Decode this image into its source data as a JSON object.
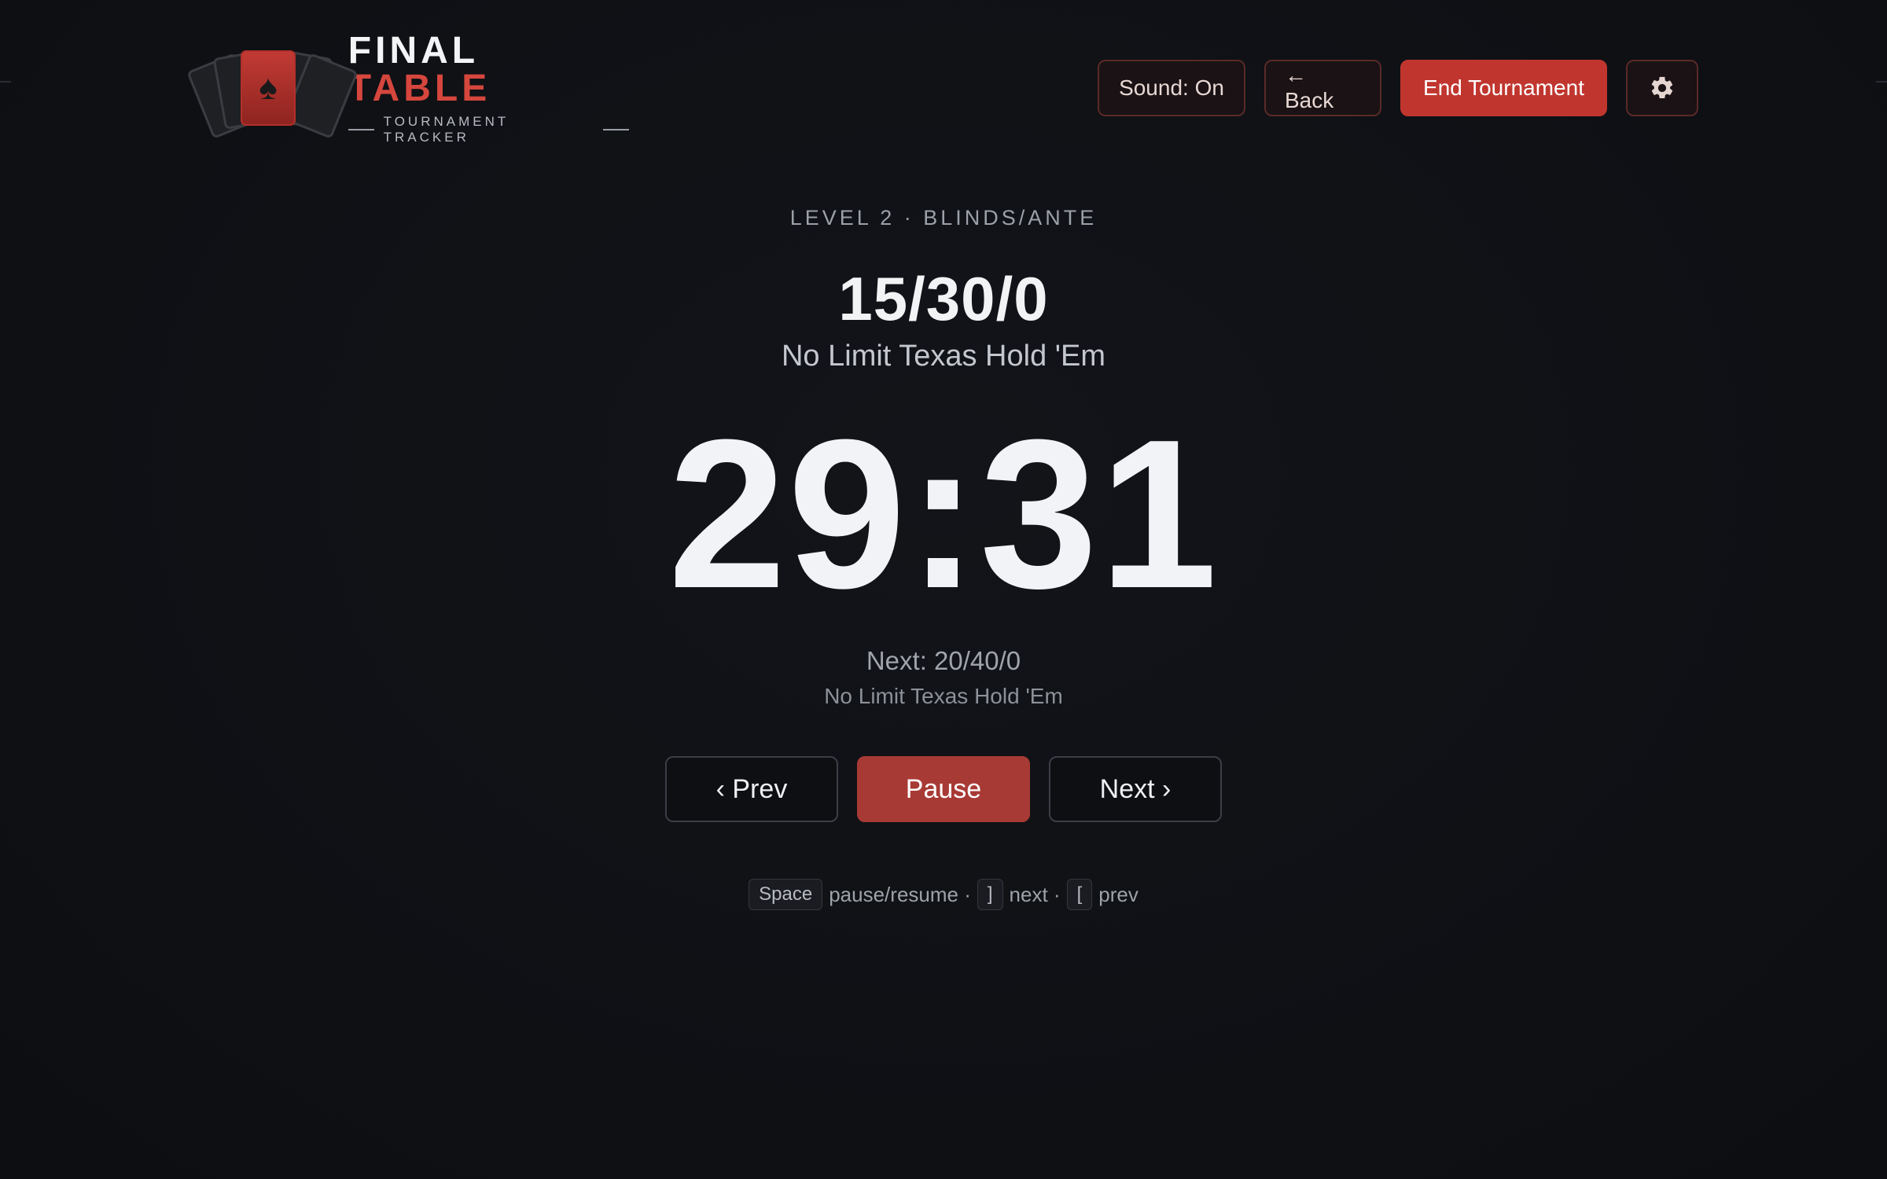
{
  "header": {
    "logo": {
      "title_white": "FINAL",
      "title_red": "TABLE",
      "subtitle": "TOURNAMENT TRACKER"
    },
    "buttons": {
      "sound": "Sound: On",
      "back": "← Back",
      "end": "End Tournament",
      "settings_icon": "gear-icon"
    }
  },
  "level": {
    "label": "LEVEL 2 · BLINDS/ANTE",
    "blinds": "15/30/0",
    "game": "No Limit Texas Hold 'Em"
  },
  "timer": {
    "display": "29:31"
  },
  "next_level": {
    "label": "Next: 20/40/0",
    "game": "No Limit Texas Hold 'Em"
  },
  "controls": {
    "prev": "‹ Prev",
    "pause": "Pause",
    "next": "Next ›"
  },
  "shortcuts": {
    "space_key": "Space",
    "space_desc": "pause/resume ·",
    "next_key": "]",
    "next_desc": "next ·",
    "prev_key": "[",
    "prev_desc": "prev"
  },
  "colors": {
    "accent": "#c0362f",
    "background": "#0f1115"
  }
}
